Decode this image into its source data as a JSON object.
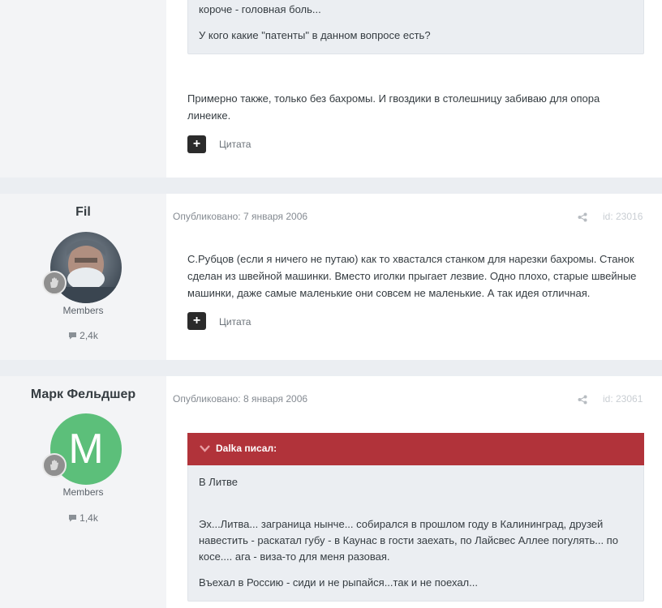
{
  "post1": {
    "quote_lines": [
      "короче - головная боль...",
      "У кого какие \"патенты\" в данном вопросе есть?"
    ],
    "body_lines": [
      "Примерно также, только без бахромы. И гвоздики в столешницу забиваю для опора",
      "линеике."
    ],
    "cite_label": "Цитата",
    "plus_label": "+"
  },
  "post2": {
    "author": "Fil",
    "group": "Members",
    "count": "2,4k",
    "published": "Опубликовано: 7 января 2006",
    "post_id": "id: 23016",
    "body_lines": [
      "С.Рубцов (если я ничего не путаю) как то хвастался станком для нарезки бахромы. Станок",
      "сделан из швейной машинки. Вместо иголки прыгает лезвие. Одно плохо, старые швейные",
      "машинки, даже самые маленькие они совсем не маленькие. А так идея отличная."
    ],
    "cite_label": "Цитата",
    "plus_label": "+"
  },
  "post3": {
    "author": "Марк Фельдшер",
    "avatar_letter": "M",
    "avatar_color": "#5cbf7a",
    "group": "Members",
    "count": "1,4k",
    "published": "Опубликовано: 8 января 2006",
    "post_id": "id: 23061",
    "quote_author": "Dalka писал:",
    "quote_color": "#b1333a",
    "quote_lines": [
      "В Литве"
    ],
    "reply_lines": [
      "Эх...Литва... заграница нынче... собирался в прошлом году в Калининград, друзей",
      "навестить - раскатал губу - в Каунас в гости заехать, по Лайсвес Аллее погулять... по",
      "косе.... ага - виза-то для меня разовая.",
      "Въехал в Россию - сиди и не рыпайся...так и не поехал..."
    ]
  }
}
